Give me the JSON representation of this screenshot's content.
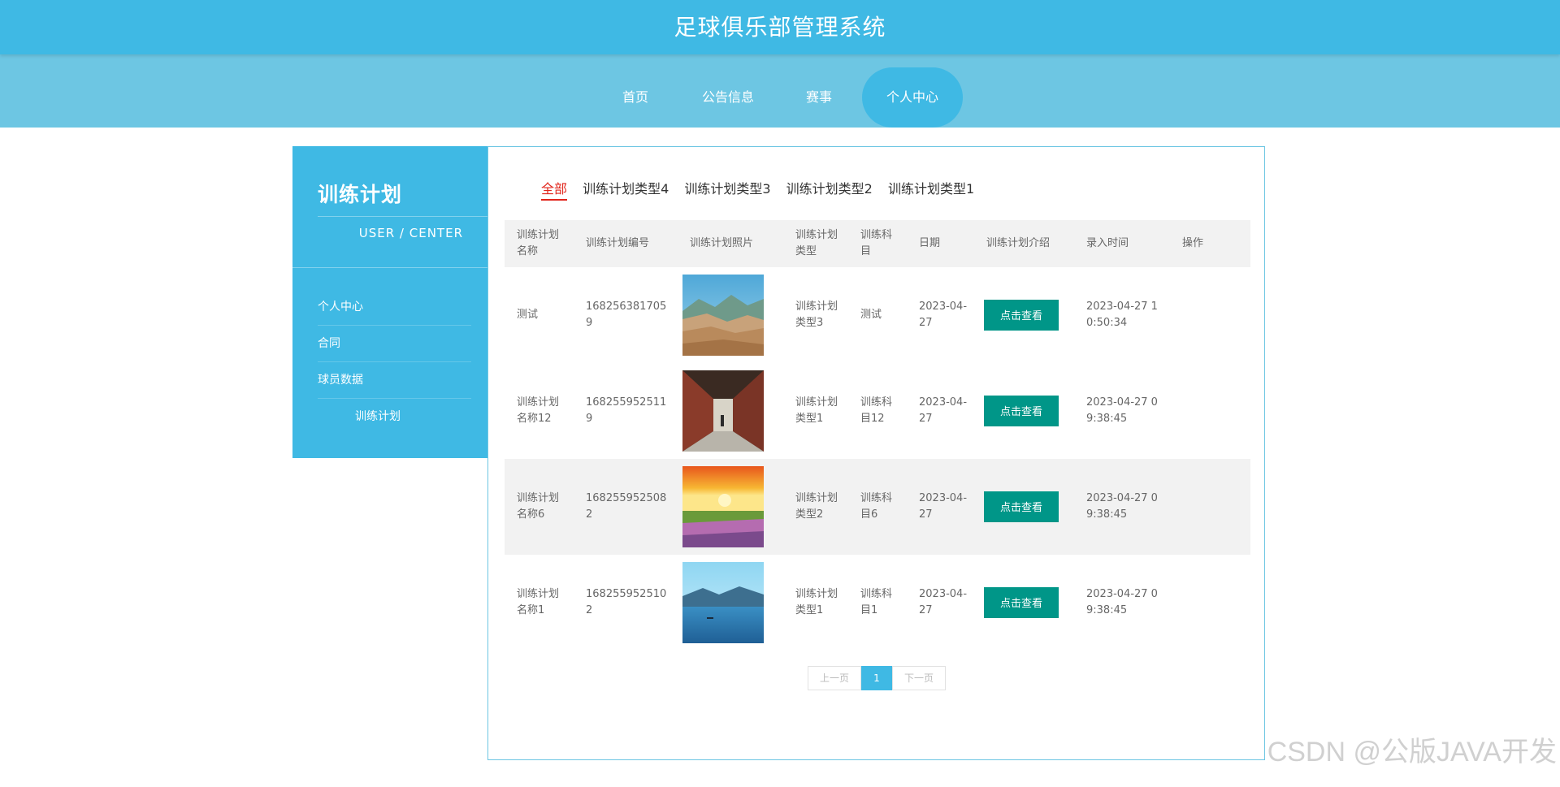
{
  "header": {
    "title": "足球俱乐部管理系统"
  },
  "nav": {
    "items": [
      "首页",
      "公告信息",
      "赛事",
      "个人中心"
    ],
    "active": "个人中心"
  },
  "sidebar": {
    "title": "训练计划",
    "subtitle": "USER / CENTER",
    "items": [
      {
        "label": "个人中心"
      },
      {
        "label": "合同"
      },
      {
        "label": "球员数据"
      },
      {
        "label": "训练计划"
      }
    ]
  },
  "filters": {
    "tabs": [
      "全部",
      "训练计划类型4",
      "训练计划类型3",
      "训练计划类型2",
      "训练计划类型1"
    ],
    "active": "全部"
  },
  "table": {
    "columns": [
      "训练计划名称",
      "训练计划编号",
      "训练计划照片",
      "训练计划类型",
      "训练科目",
      "日期",
      "训练计划介绍",
      "录入时间",
      "操作"
    ],
    "view_label": "点击查看",
    "rows": [
      {
        "name": "测试",
        "code": "1682563817059",
        "photo": "mountain-valley",
        "type": "训练计划类型3",
        "subject": "测试",
        "date": "2023-04-27",
        "created": "2023-04-27 10:50:34"
      },
      {
        "name": "训练计划名称12",
        "code": "1682559525119",
        "photo": "corridor",
        "type": "训练计划类型1",
        "subject": "训练科目12",
        "date": "2023-04-27",
        "created": "2023-04-27 09:38:45"
      },
      {
        "name": "训练计划名称6",
        "code": "1682559525082",
        "photo": "sunset-field",
        "type": "训练计划类型2",
        "subject": "训练科目6",
        "date": "2023-04-27",
        "created": "2023-04-27 09:38:45"
      },
      {
        "name": "训练计划名称1",
        "code": "1682559525102",
        "photo": "lake",
        "type": "训练计划类型1",
        "subject": "训练科目1",
        "date": "2023-04-27",
        "created": "2023-04-27 09:38:45"
      }
    ]
  },
  "pagination": {
    "prev": "上一页",
    "current": "1",
    "next": "下一页"
  },
  "watermark": "CSDN @公版JAVA开发",
  "colors": {
    "primary": "#3fb9e4",
    "nav": "#6dc6e3",
    "button": "#009688",
    "active_filter": "#e1251b"
  }
}
